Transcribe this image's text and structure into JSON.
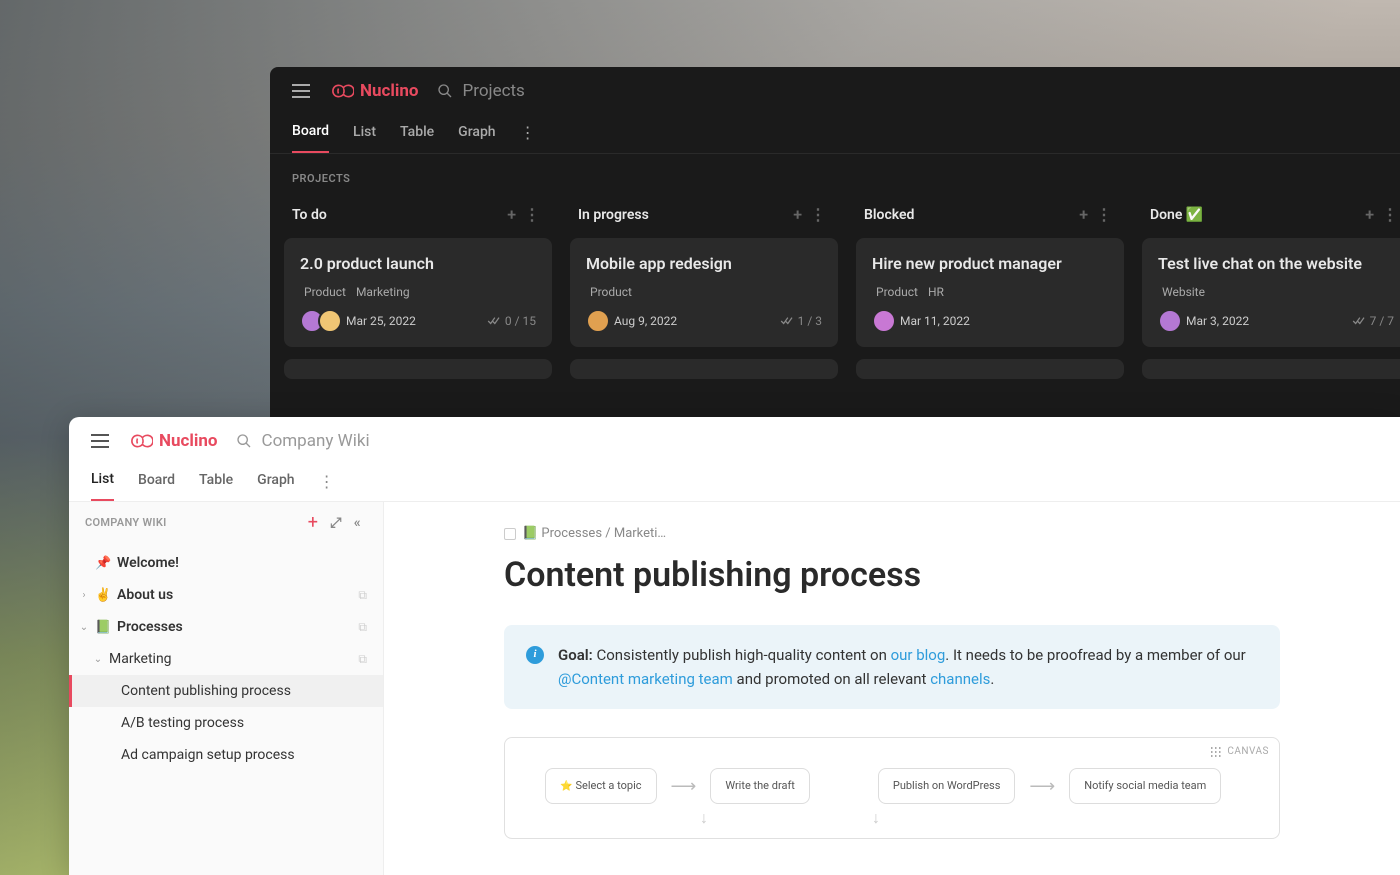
{
  "dark": {
    "brand": "Nuclino",
    "search_placeholder": "Projects",
    "tabs": [
      "Board",
      "List",
      "Table",
      "Graph"
    ],
    "active_tab": 0,
    "section_label": "PROJECTS",
    "columns": [
      {
        "title": "To do",
        "cards": [
          {
            "title": "2.0 product launch",
            "tags": [
              "Product",
              "Marketing"
            ],
            "date": "Mar 25, 2022",
            "check": "0 / 15",
            "avatars": [
              "#b478d4",
              "#f0c674"
            ]
          }
        ]
      },
      {
        "title": "In progress",
        "cards": [
          {
            "title": "Mobile app redesign",
            "tags": [
              "Product"
            ],
            "date": "Aug 9, 2022",
            "check": "1 / 3",
            "avatars": [
              "#e0a050"
            ]
          }
        ]
      },
      {
        "title": "Blocked",
        "cards": [
          {
            "title": "Hire new product manager",
            "tags": [
              "Product",
              "HR"
            ],
            "date": "Mar 11, 2022",
            "check": "",
            "avatars": [
              "#c878d4"
            ]
          }
        ]
      },
      {
        "title": "Done ✅",
        "cards": [
          {
            "title": "Test live chat on the website",
            "tags": [
              "Website"
            ],
            "date": "Mar 3, 2022",
            "check": "7 / 7",
            "avatars": [
              "#b478d4"
            ]
          }
        ]
      }
    ]
  },
  "light": {
    "brand": "Nuclino",
    "search_placeholder": "Company Wiki",
    "tabs": [
      "List",
      "Board",
      "Table",
      "Graph"
    ],
    "active_tab": 0,
    "sidebar": {
      "title": "COMPANY WIKI",
      "items": [
        {
          "emoji": "📌",
          "label": "Welcome!",
          "chev": "",
          "bold": true,
          "indent": 0,
          "copy": false
        },
        {
          "emoji": "✌️",
          "label": "About us",
          "chev": "›",
          "bold": true,
          "indent": 0,
          "copy": true
        },
        {
          "emoji": "📗",
          "label": "Processes",
          "chev": "⌄",
          "bold": true,
          "indent": 0,
          "copy": true
        },
        {
          "emoji": "",
          "label": "Marketing",
          "chev": "⌄",
          "bold": false,
          "indent": 1,
          "copy": true
        },
        {
          "emoji": "",
          "label": "Content publishing process",
          "chev": "",
          "bold": false,
          "indent": 2,
          "copy": false,
          "selected": true
        },
        {
          "emoji": "",
          "label": "A/B testing process",
          "chev": "",
          "bold": false,
          "indent": 2,
          "copy": false
        },
        {
          "emoji": "",
          "label": "Ad campaign setup process",
          "chev": "",
          "bold": false,
          "indent": 2,
          "copy": false
        }
      ]
    },
    "content": {
      "breadcrumb": "📗 Processes / Marketi…",
      "title": "Content publishing process",
      "callout": {
        "goal_label": "Goal:",
        "text1": " Consistently publish high-quality content on ",
        "link1": "our blog",
        "text2": ". It needs to be proofread by a member of our ",
        "link2": "@Content marketing team",
        "text3": " and promoted on all relevant ",
        "link3": "channels",
        "text4": "."
      },
      "canvas_label": "CANVAS",
      "flow": [
        "Select a topic",
        "Write the draft",
        "Publish on WordPress",
        "Notify social media team"
      ]
    }
  }
}
